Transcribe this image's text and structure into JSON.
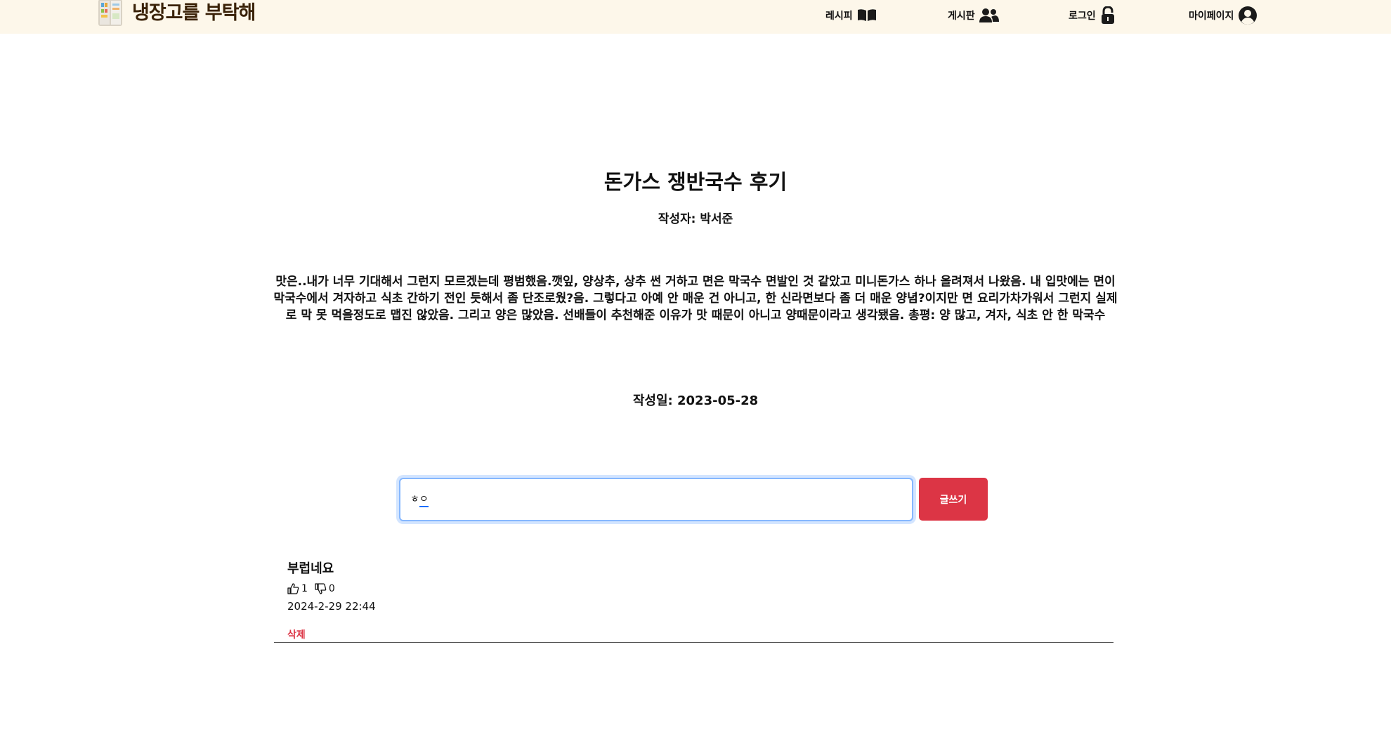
{
  "header": {
    "logo_text": "냉장고를 부탁해",
    "nav": {
      "recipe_label": "레시피",
      "board_label": "게시판",
      "login_label": "로그인",
      "mypage_label": "마이페이지"
    }
  },
  "post": {
    "title": "돈가스 쟁반국수 후기",
    "author": "작성자: 박서준",
    "body": "맛은..내가 너무 기대해서 그런지 모르겠는데 평범했음.깻잎, 양상추, 상추 썬 거하고 면은 막국수 면발인 것 같았고 미니돈가스 하나 올려져서 나왔음. 내 입맛에는 면이 막국수에서 겨자하고 식초 간하기 전인 듯해서 좀 단조로웠?음. 그렇다고 아예 안 매운 건 아니고, 한 신라면보다 좀 더 매운 양념?이지만 면 요리가차가워서 그런지 실제로 막 못 먹을정도로 맵진 않았음. 그리고 양은 많았음. 선배들이 추천해준 이유가 맛 때문이 아니고 양때문이라고 생각됐음. 총평: 양 많고, 겨자, 식초 안 한 막국수",
    "date": "작성일: 2023-05-28"
  },
  "comment_form": {
    "input_value_prefix": "ㅎ",
    "input_value_composing": "ㅇ",
    "submit_label": "글쓰기"
  },
  "comments": [
    {
      "text": "부럽네요",
      "likes": "1",
      "dislikes": "0",
      "date": "2024-2-29 22:44",
      "delete_label": "삭제"
    }
  ],
  "colors": {
    "header_bg": "#fdf7ea",
    "logo": "#3a2208",
    "accent_red": "#dc3545",
    "focus_blue": "#86b7fe"
  }
}
